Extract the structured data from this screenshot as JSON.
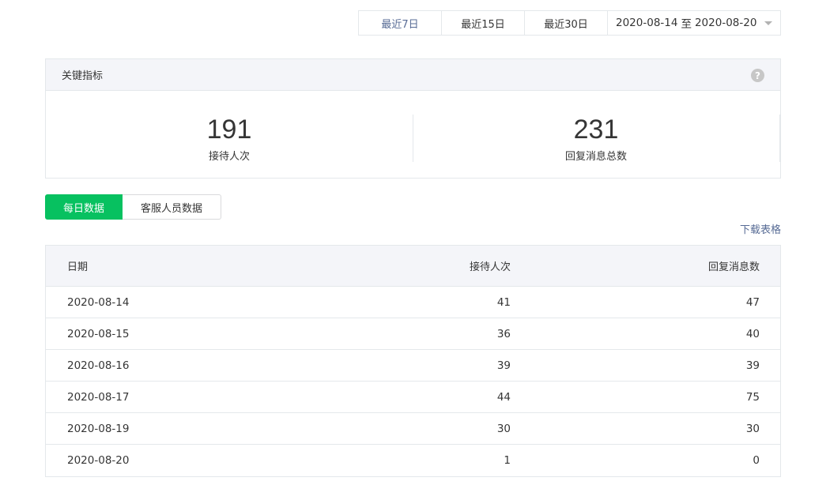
{
  "range": {
    "buttons": [
      "最近7日",
      "最近15日",
      "最近30日"
    ],
    "start": "2020-08-14",
    "sep": "至",
    "end": "2020-08-20"
  },
  "metrics_card": {
    "title": "关键指标",
    "help": "?",
    "items": [
      {
        "value": "191",
        "label": "接待人次"
      },
      {
        "value": "231",
        "label": "回复消息总数"
      }
    ]
  },
  "tabs": [
    "每日数据",
    "客服人员数据"
  ],
  "download_label": "下载表格",
  "table": {
    "headers": [
      "日期",
      "接待人次",
      "回复消息数"
    ],
    "rows": [
      [
        "2020-08-14",
        "41",
        "47"
      ],
      [
        "2020-08-15",
        "36",
        "40"
      ],
      [
        "2020-08-16",
        "39",
        "39"
      ],
      [
        "2020-08-17",
        "44",
        "75"
      ],
      [
        "2020-08-19",
        "30",
        "30"
      ],
      [
        "2020-08-20",
        "1",
        "0"
      ]
    ]
  },
  "colors": {
    "accent": "#07c160",
    "link": "#576b95"
  }
}
